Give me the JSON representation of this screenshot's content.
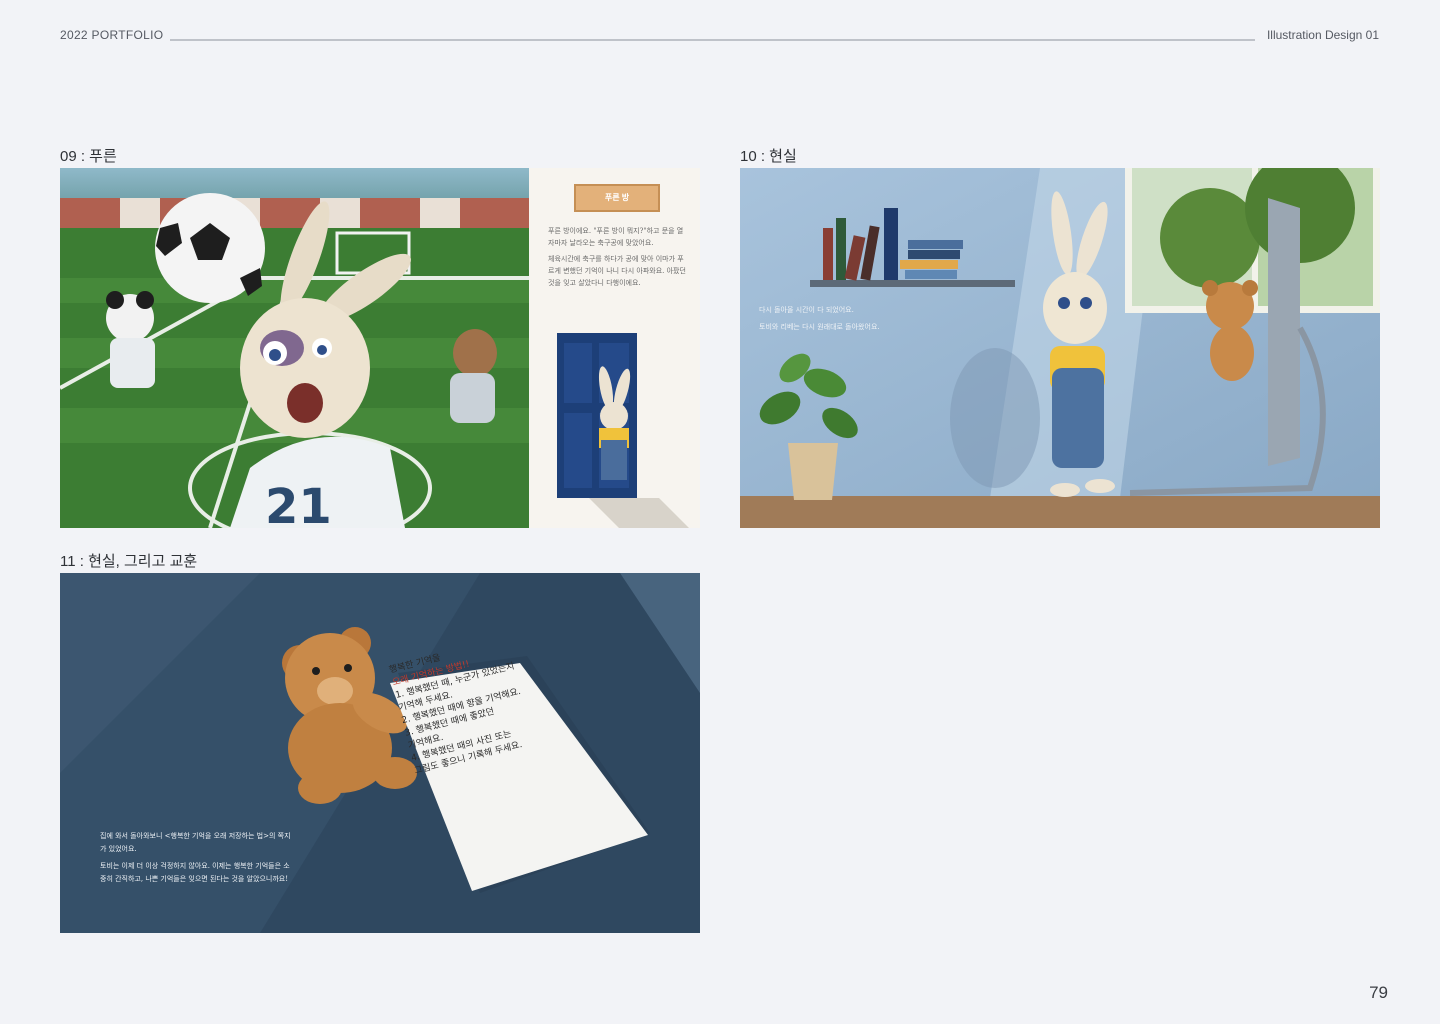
{
  "header": {
    "left": "2022 PORTFOLIO",
    "right": "Illustration Design 01"
  },
  "panels": [
    {
      "caption": "09 : 푸른",
      "sign": "푸른 방",
      "story": [
        "푸른 방이에요. \"푸른 방이 뭐지?\"하고 문을 열자마자 날라오는 축구공에 맞았어요.",
        "체육시간에 축구를 하다가 공에 맞아 이마가 푸르게 변했던 기억이 나니 다시 아파와요. 아팠던 것을 잊고 살았다니 다행이에요."
      ],
      "jersey_number": "21"
    },
    {
      "caption": "10 : 현실",
      "story": [
        "다시 돌아올 시간이 다 되었어요.",
        "토비와 리베는 다시 원래대로 돌아왔어요."
      ]
    },
    {
      "caption": "11 : 현실, 그리고 교훈",
      "story": [
        "집에 와서 돌아와보니 <행복한 기억을 오래 저장하는 법>의 쪽지가 있었어요.",
        "토비는 이제 더 이상 걱정하지 않아요. 이제는 행복한 기억들은 소중히 간직하고, 나쁜 기억들은 잊으면 된다는 것을 알았으니까요!"
      ],
      "note_lines": [
        "행복한 기억을",
        "오래 기억하는 방법!!",
        "1. 행복했던 때, 누군가 있었는지",
        "   기억해 두세요.",
        "2. 행복했던 때에 향을 기억해요.",
        "3. 행복했던 때에 좋았던",
        "   기억해요.",
        "4. 행복했던 때의 사진 또는",
        "   그림도 좋으니 기록해 두세요."
      ]
    }
  ],
  "page_number": "79"
}
